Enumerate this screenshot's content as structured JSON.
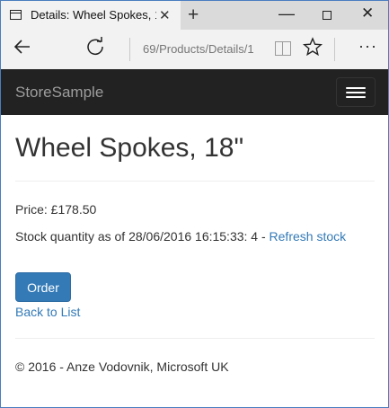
{
  "browser": {
    "tab_title": "Details: Wheel Spokes, 1",
    "tab_close": "✕",
    "new_tab": "+",
    "minimize": "—",
    "close": "✕",
    "url": "69/Products/Details/1",
    "more": "···"
  },
  "site": {
    "brand": "StoreSample"
  },
  "product": {
    "title": "Wheel Spokes, 18\"",
    "price_text": "Price: £178.50",
    "stock_text": "Stock quantity as of 28/06/2016 16:15:33: 4 - ",
    "refresh_link": "Refresh stock",
    "order_button": "Order",
    "back_link": "Back to List"
  },
  "footer": {
    "text": "© 2016 - Anze Vodovnik, Microsoft UK"
  },
  "colors": {
    "navbar": "#222222",
    "link": "#337ab7",
    "button": "#337ab7"
  }
}
